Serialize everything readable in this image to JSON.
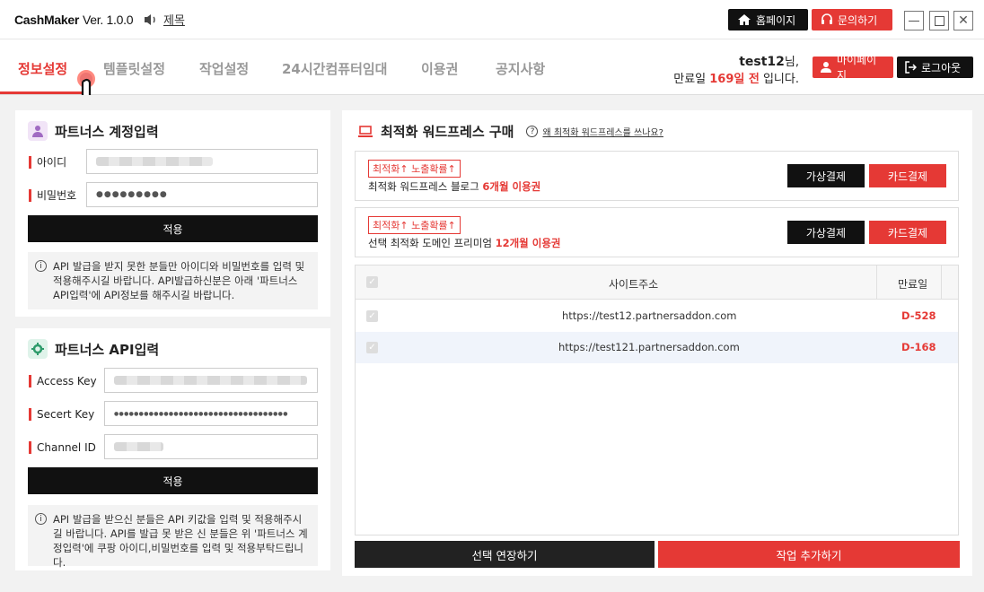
{
  "app": {
    "logo": "CashMaker",
    "version": "Ver. 1.0.0",
    "sound_label": "제목"
  },
  "titlebar": {
    "home": "홈페이지",
    "ask": "문의하기"
  },
  "nav": {
    "tabs": [
      "정보설정",
      "템플릿설정",
      "작업설정",
      "24시간컴퓨터임대",
      "이용권",
      "공지사항"
    ],
    "user": {
      "name": "test12",
      "suffix": "님,",
      "expire_prefix": "만료일 ",
      "days": "169일 전",
      "expire_suffix": " 입니다."
    },
    "mypage": "마이페이지",
    "logout": "로그아웃"
  },
  "partners_account": {
    "title": "파트너스 계정입력",
    "id_label": "아이디",
    "pw_label": "비밀번호",
    "pw_value": "●●●●●●●●●",
    "apply": "적용",
    "info": "API 발급을 받지 못한 분들만 아이디와 비밀번호를 입력 및 적용해주시길 바랍니다.  API발급하신분은 아래 '파트너스 API입력'에 API정보를 해주시길 바랍니다."
  },
  "partners_api": {
    "title": "파트너스 API입력",
    "access_label": "Access Key",
    "secret_label": "Secert Key",
    "secret_value": "●●●●●●●●●●●●●●●●●●●●●●●●●●●●●●●●●●●",
    "channel_label": "Channel ID",
    "apply": "적용",
    "info": "API 발급을 받으신 분들은 API 키값을 입력 및 적용해주시길 바랍니다. API를 발급 못 받은 신 분들은 위 '파트너스 계정입력'에 쿠팡 아이디,비밀번호를 입력 및 적용부탁드립니다."
  },
  "wordpress": {
    "title": "최적화 워드프레스 구매",
    "help": "왜 최적화 워드프레스를 쓰나요?",
    "offers": [
      {
        "tag": "최적화↑ 노출확률↑",
        "text": "최적화 워드프레스 블로그 ",
        "highlight": "6개월 이용권",
        "virtual": "가상결제",
        "card": "카드결제"
      },
      {
        "tag": "최적화↑ 노출확률↑",
        "text": "선택 최적화 도메인 프리미엄 ",
        "highlight": "12개월 이용권",
        "virtual": "가상결제",
        "card": "카드결제"
      }
    ]
  },
  "sites_table": {
    "columns": [
      "사이트주소",
      "만료일"
    ],
    "rows": [
      {
        "url": "https://test12.partnersaddon.com",
        "expire": "D-528"
      },
      {
        "url": "https://test121.partnersaddon.com",
        "expire": "D-168"
      }
    ]
  },
  "actions": {
    "extend": "선택 연장하기",
    "add": "작업 추가하기"
  },
  "colors": {
    "accent": "#e53935",
    "dark": "#111111"
  }
}
